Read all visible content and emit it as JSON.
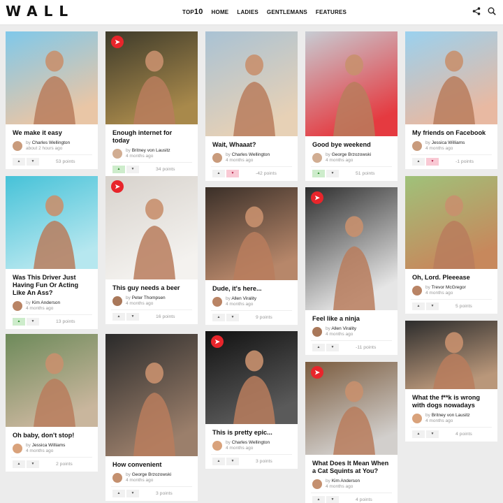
{
  "header": {
    "logo": "WALL",
    "nav": [
      {
        "prefix": "TOP",
        "big": "10",
        "label": ""
      },
      {
        "prefix": "",
        "big": "",
        "label": "HOME"
      },
      {
        "prefix": "",
        "big": "",
        "label": "LADIES"
      },
      {
        "prefix": "",
        "big": "",
        "label": "GENTLEMANS"
      },
      {
        "prefix": "",
        "big": "",
        "label": "FEATURES"
      }
    ],
    "icons": [
      "share-icon",
      "search-icon"
    ]
  },
  "colors": {
    "hot_badge": "#e8252b",
    "vote_up_active": "#cdeccb",
    "vote_down_active": "#f9c9d4"
  },
  "cards": [
    {
      "title": "We make it easy",
      "by": "by",
      "author": "Charles Wellington",
      "time": "about 2 hours ago",
      "points": "53 points",
      "vote": "none",
      "hot": false
    },
    {
      "title": "Was This Driver Just Having Fun Or Acting Like An Ass?",
      "by": "by",
      "author": "Kim Anderson",
      "time": "4 months ago",
      "points": "13 points",
      "vote": "up",
      "hot": false
    },
    {
      "title": "Oh baby, don't stop!",
      "by": "by",
      "author": "Jessica Williams",
      "time": "4 months ago",
      "points": "2 points",
      "vote": "none",
      "hot": false
    },
    {
      "title": "Enough internet for today",
      "by": "by",
      "author": "Britney von Lausitz",
      "time": "4 months ago",
      "points": "34 points",
      "vote": "up",
      "hot": true
    },
    {
      "title": "This guy needs a beer",
      "by": "by",
      "author": "Peter Thompsen",
      "time": "4 months ago",
      "points": "16 points",
      "vote": "none",
      "hot": true
    },
    {
      "title": "How convenient",
      "by": "by",
      "author": "George Brzozowski",
      "time": "4 months ago",
      "points": "3 points",
      "vote": "none",
      "hot": false
    },
    {
      "title": "Wait, Whaaat?",
      "by": "by",
      "author": "Charles Wellington",
      "time": "4 months ago",
      "points": "-42 points",
      "vote": "down",
      "hot": false
    },
    {
      "title": "Dude, it's here...",
      "by": "by",
      "author": "Allen Virality",
      "time": "4 months ago",
      "points": "9 points",
      "vote": "none",
      "hot": false
    },
    {
      "title": "This is pretty epic...",
      "by": "by",
      "author": "Charles Wellington",
      "time": "4 months ago",
      "points": "3 points",
      "vote": "none",
      "hot": true
    },
    {
      "title": "Good bye weekend",
      "by": "by",
      "author": "George Brzozowski",
      "time": "4 months ago",
      "points": "51 points",
      "vote": "up",
      "hot": false
    },
    {
      "title": "Feel like a ninja",
      "by": "by",
      "author": "Allen Virality",
      "time": "4 months ago",
      "points": "-11 points",
      "vote": "none",
      "hot": true
    },
    {
      "title": "What Does It Mean When a Cat Squints at You?",
      "by": "by",
      "author": "Kim Anderson",
      "time": "4 months ago",
      "points": "4 points",
      "vote": "none",
      "hot": true
    },
    {
      "title": "My friends on Facebook",
      "by": "by",
      "author": "Jessica Williams",
      "time": "4 months ago",
      "points": "-1 points",
      "vote": "down",
      "hot": false
    },
    {
      "title": "Oh, Lord. Pleeease",
      "by": "by",
      "author": "Trevor McGregor",
      "time": "4 months ago",
      "points": "5 points",
      "vote": "none",
      "hot": false
    },
    {
      "title": "What the f**k is wrong with dogs nowadays",
      "by": "by",
      "author": "Britney von Lausitz",
      "time": "4 months ago",
      "points": "4 points",
      "vote": "none",
      "hot": false
    }
  ]
}
